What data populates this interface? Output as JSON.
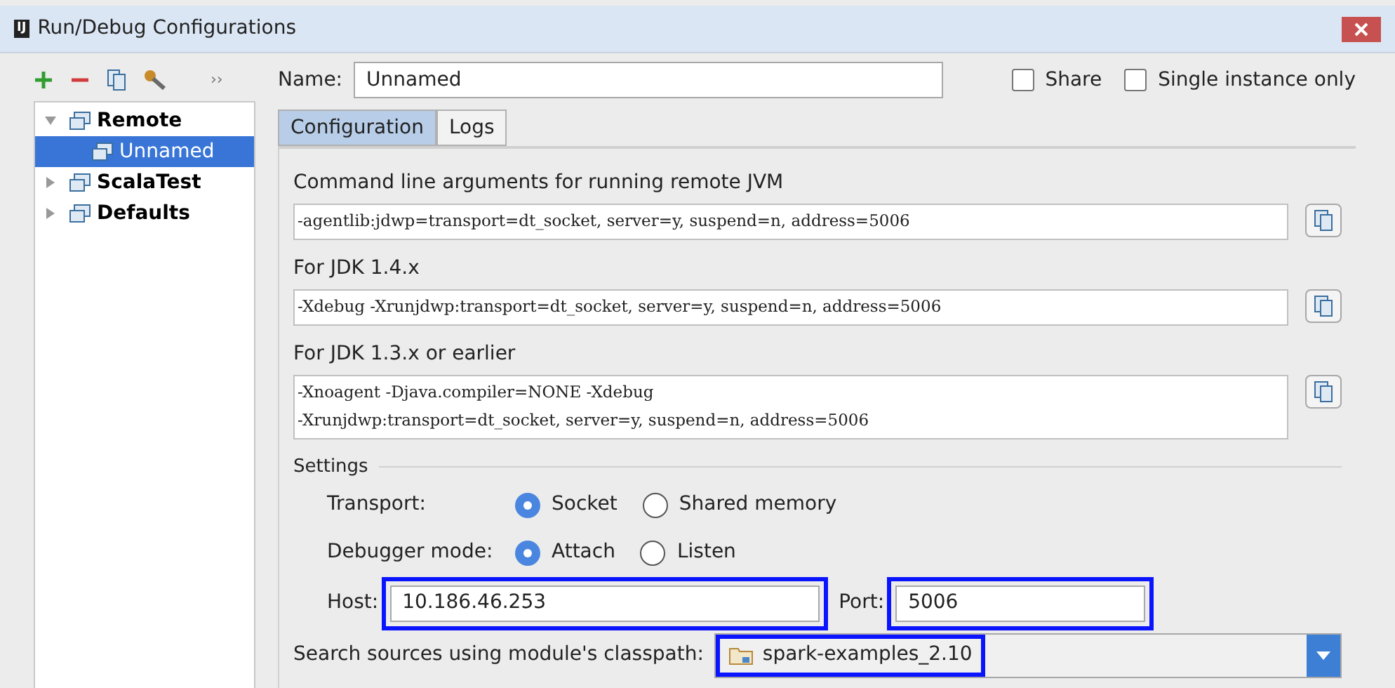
{
  "window": {
    "title": "Run/Debug Configurations",
    "app_icon": "IJ"
  },
  "toolbar": {
    "more": "››"
  },
  "tree": [
    {
      "label": "Remote",
      "bold": true,
      "expanded": true,
      "selected": false,
      "children": [
        {
          "label": "Unnamed",
          "bold": false,
          "selected": true
        }
      ]
    },
    {
      "label": "ScalaTest",
      "bold": true,
      "expanded": false,
      "selected": false
    },
    {
      "label": "Defaults",
      "bold": true,
      "expanded": false,
      "selected": false
    }
  ],
  "name_field": {
    "label": "Name:",
    "value": "Unnamed"
  },
  "checkboxes": [
    {
      "label": "Share",
      "checked": false
    },
    {
      "label": "Single instance only",
      "checked": false
    }
  ],
  "tabs": [
    {
      "label": "Configuration",
      "selected": true
    },
    {
      "label": "Logs",
      "selected": false
    }
  ],
  "arguments": [
    {
      "label": "Command line arguments for running remote JVM",
      "lines": [
        "-agentlib:jdwp=transport=dt_socket, server=y, suspend=n, address=5006"
      ]
    },
    {
      "label": "For JDK 1.4.x",
      "lines": [
        "-Xdebug -Xrunjdwp:transport=dt_socket, server=y, suspend=n, address=5006"
      ]
    },
    {
      "label": "For JDK 1.3.x or earlier",
      "lines": [
        "-Xnoagent -Djava.compiler=NONE -Xdebug",
        "-Xrunjdwp:transport=dt_socket, server=y, suspend=n, address=5006"
      ]
    }
  ],
  "settings": {
    "title": "Settings",
    "radio_groups": [
      {
        "label": "Transport:",
        "options": [
          {
            "label": "Socket",
            "selected": true
          },
          {
            "label": "Shared memory",
            "selected": false
          }
        ]
      },
      {
        "label": "Debugger mode:",
        "options": [
          {
            "label": "Attach",
            "selected": true
          },
          {
            "label": "Listen",
            "selected": false
          }
        ]
      }
    ],
    "host": {
      "label": "Host:",
      "value": "10.186.46.253",
      "highlighted": true
    },
    "port": {
      "label": "Port:",
      "value": "5006",
      "highlighted": true
    },
    "module": {
      "label": "Search sources using module's classpath:",
      "value": "spark-examples_2.10",
      "highlighted": true
    }
  }
}
